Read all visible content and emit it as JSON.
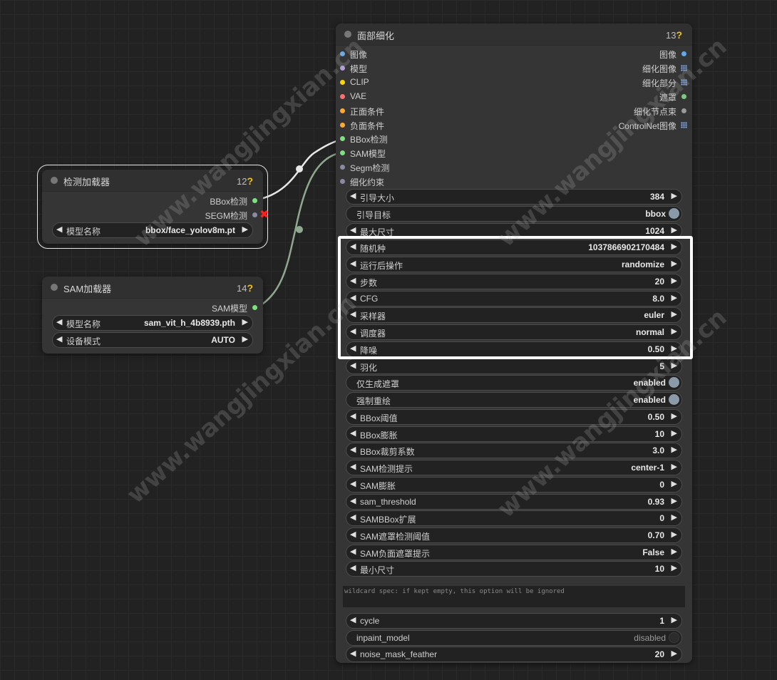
{
  "colors": {
    "image": "#64a8e8",
    "model": "#b39ddb",
    "clip": "#ffd500",
    "vae": "#ff6e6e",
    "cond_pos": "#ffa931",
    "cond_neg": "#ffa931",
    "bbox": "#7ee07e",
    "sam": "#7ee07e",
    "segm": "#8a8aa0",
    "detailer": "#8a8aa0",
    "mask": "#81c784",
    "neutral": "#9a9a9a"
  },
  "detector_node": {
    "title": "检测加载器",
    "id": "12",
    "outputs": [
      {
        "label": "BBox检测"
      },
      {
        "label": "SEGM检测"
      }
    ],
    "widgets": [
      {
        "label": "模型名称",
        "value": "bbox/face_yolov8m.pt"
      }
    ]
  },
  "sam_node": {
    "title": "SAM加载器",
    "id": "14",
    "outputs": [
      {
        "label": "SAM模型"
      }
    ],
    "widgets": [
      {
        "label": "模型名称",
        "value": "sam_vit_h_4b8939.pth"
      },
      {
        "label": "设备模式",
        "value": "AUTO"
      }
    ]
  },
  "face_node": {
    "title": "面部细化",
    "id": "13",
    "inputs": [
      {
        "label": "图像"
      },
      {
        "label": "模型"
      },
      {
        "label": "CLIP"
      },
      {
        "label": "VAE"
      },
      {
        "label": "正面条件"
      },
      {
        "label": "负面条件"
      },
      {
        "label": "BBox检测"
      },
      {
        "label": "SAM模型"
      },
      {
        "label": "Segm检测"
      },
      {
        "label": "细化约束"
      }
    ],
    "outputs": [
      {
        "label": "图像"
      },
      {
        "label": "细化图像"
      },
      {
        "label": "细化部分"
      },
      {
        "label": "遮罩"
      },
      {
        "label": "细化节点束"
      },
      {
        "label": "ControlNet图像"
      }
    ],
    "widgets": [
      {
        "label": "引导大小",
        "value": "384"
      },
      {
        "label": "引导目标",
        "value": "bbox"
      },
      {
        "label": "最大尺寸",
        "value": "1024"
      },
      {
        "label": "随机种",
        "value": "1037866902170484"
      },
      {
        "label": "运行后操作",
        "value": "randomize"
      },
      {
        "label": "步数",
        "value": "20"
      },
      {
        "label": "CFG",
        "value": "8.0"
      },
      {
        "label": "采样器",
        "value": "euler"
      },
      {
        "label": "调度器",
        "value": "normal"
      },
      {
        "label": "降噪",
        "value": "0.50"
      },
      {
        "label": "羽化",
        "value": "5"
      },
      {
        "label": "仅生成遮罩",
        "value": "enabled"
      },
      {
        "label": "强制重绘",
        "value": "enabled"
      },
      {
        "label": "BBox阈值",
        "value": "0.50"
      },
      {
        "label": "BBox膨胀",
        "value": "10"
      },
      {
        "label": "BBox裁剪系数",
        "value": "3.0"
      },
      {
        "label": "SAM检测提示",
        "value": "center-1"
      },
      {
        "label": "SAM膨胀",
        "value": "0"
      },
      {
        "label": "sam_threshold",
        "value": "0.93"
      },
      {
        "label": "SAMBBox扩展",
        "value": "0"
      },
      {
        "label": "SAM遮罩检测阈值",
        "value": "0.70"
      },
      {
        "label": "SAM负面遮罩提示",
        "value": "False"
      },
      {
        "label": "最小尺寸",
        "value": "10"
      }
    ],
    "wildcard_text": "wildcard spec: if kept empty, this option will be ignored",
    "bottom_widgets": [
      {
        "label": "cycle",
        "value": "1"
      },
      {
        "label": "inpaint_model",
        "value": "disabled"
      },
      {
        "label": "noise_mask_feather",
        "value": "20"
      }
    ]
  },
  "watermark": "www.wangjingxian.cn"
}
